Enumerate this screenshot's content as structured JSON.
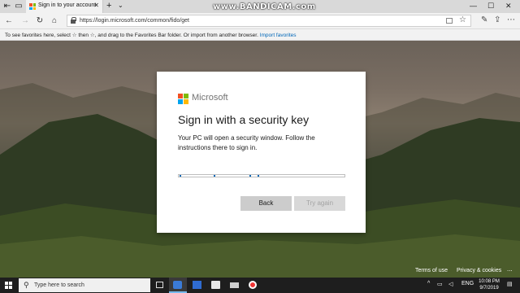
{
  "browser": {
    "tab_title": "Sign in to your account",
    "url": "https://login.microsoft.com/common/fido/get",
    "new_tab_glyph": "+",
    "favorites_message": "To see favorites here, select ☆ then ☆, and drag to the Favorites Bar folder. Or import from another browser.",
    "import_link": "Import favorites"
  },
  "watermark": "www.BANDICAM.com",
  "dialog": {
    "brand": "Microsoft",
    "heading": "Sign in with a security key",
    "description": "Your PC will open a security window. Follow the instructions there to sign in.",
    "back_label": "Back",
    "try_again_label": "Try again",
    "progress_dots": 4
  },
  "footer": {
    "terms": "Terms of use",
    "privacy": "Privacy & cookies",
    "more": "..."
  },
  "taskbar": {
    "search_placeholder": "Type here to search",
    "language": "ENG",
    "time": "10:08 PM",
    "date": "9/7/2019"
  },
  "colors": {
    "ms_red": "#f25022",
    "ms_green": "#7fba00",
    "ms_blue": "#00a4ef",
    "ms_yellow": "#ffb900",
    "accent": "#0067b8"
  },
  "icons": [
    "back-arrow-icon",
    "forward-arrow-icon",
    "refresh-icon",
    "home-icon",
    "lock-icon",
    "star-icon",
    "pen-icon",
    "share-icon",
    "more-icon",
    "search-icon",
    "windows-logo-icon"
  ]
}
